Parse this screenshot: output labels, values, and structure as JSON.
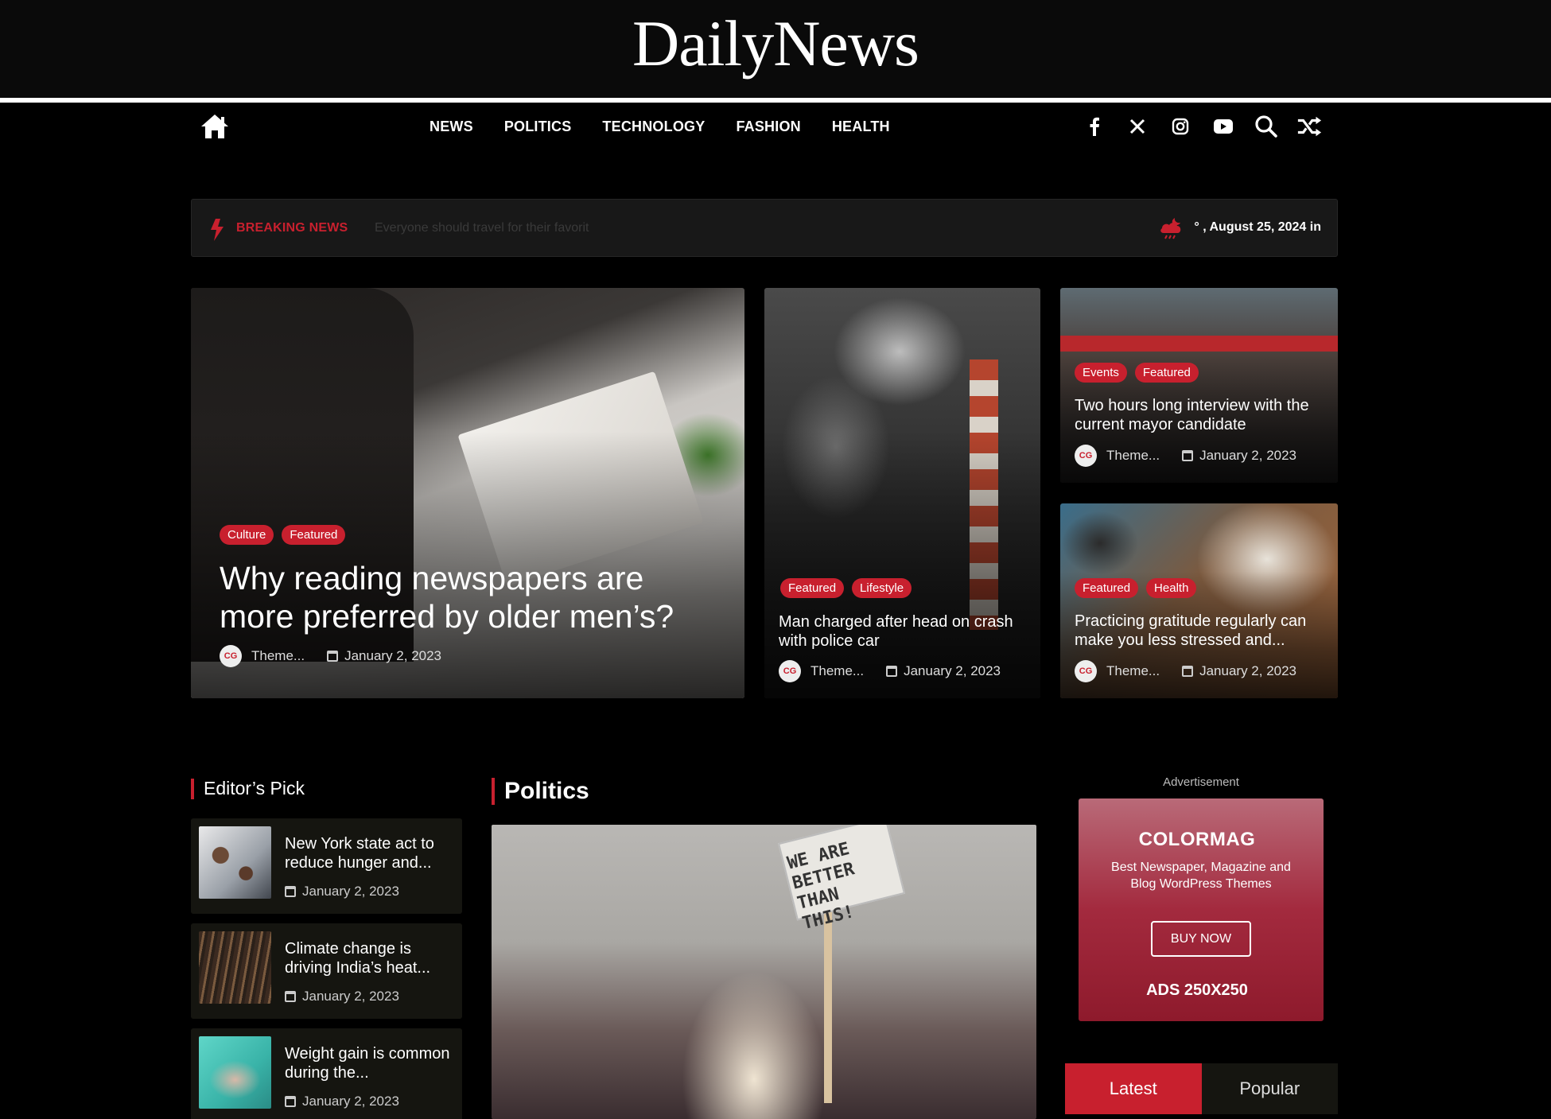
{
  "site": {
    "logo": "DailyNews"
  },
  "nav": {
    "items": [
      "NEWS",
      "POLITICS",
      "TECHNOLOGY",
      "FASHION",
      "HEALTH"
    ],
    "icons": [
      "facebook-icon",
      "x-icon",
      "instagram-icon",
      "youtube-icon",
      "search-icon",
      "shuffle-icon"
    ]
  },
  "breaking": {
    "label": "BREAKING NEWS",
    "ticker": "Everyone should travel for their favorit",
    "weather_date": "° , August 25, 2024 in"
  },
  "featured": [
    {
      "tags": [
        "Culture",
        "Featured"
      ],
      "title": "Why reading newspapers are more preferred by older men’s?",
      "author": "Theme...",
      "date": "January 2, 2023"
    },
    {
      "tags": [
        "Featured",
        "Lifestyle"
      ],
      "title": "Man charged after head on crash with police car",
      "author": "Theme...",
      "date": "January 2, 2023"
    },
    {
      "tags": [
        "Events",
        "Featured"
      ],
      "title": "Two hours long interview with the current mayor candidate",
      "author": "Theme...",
      "date": "January 2, 2023"
    },
    {
      "tags": [
        "Featured",
        "Health"
      ],
      "title": "Practicing gratitude regularly can make you less stressed and...",
      "author": "Theme...",
      "date": "January 2, 2023"
    }
  ],
  "editors_pick": {
    "heading": "Editor’s Pick",
    "items": [
      {
        "title": "New York state act to reduce hunger and...",
        "date": "January 2, 2023"
      },
      {
        "title": "Climate change is driving India’s heat...",
        "date": "January 2, 2023"
      },
      {
        "title": "Weight gain is common during the...",
        "date": "January 2, 2023"
      }
    ]
  },
  "politics": {
    "heading": "Politics",
    "sign_text": "WE ARE BETTER THAN THIS!"
  },
  "ad": {
    "label": "Advertisement",
    "title": "COLORMAG",
    "subtitle": "Best Newspaper, Magazine and Blog WordPress Themes",
    "button": "BUY NOW",
    "size": "ADS 250X250"
  },
  "tabs": {
    "latest": "Latest",
    "popular": "Popular"
  },
  "colors": {
    "accent": "#c8202e",
    "background": "#000000",
    "panel": "#151510"
  },
  "avatar_text": "CG"
}
